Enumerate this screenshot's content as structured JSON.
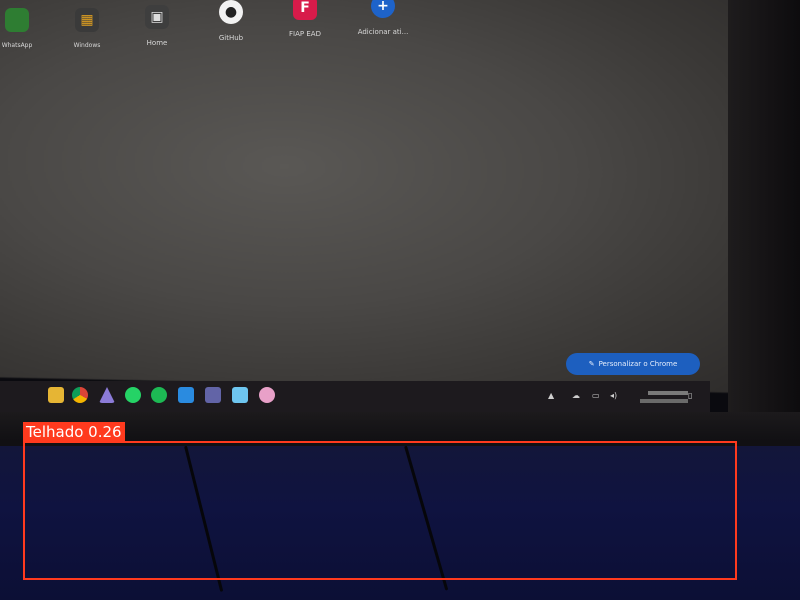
{
  "desktop": {
    "icons": [
      {
        "label": "WhatsApp",
        "color": "#2e7d32",
        "glyph": "●",
        "icon": "whatsapp-icon"
      },
      {
        "label": "Windows",
        "color": "#c0392b",
        "glyph": "▦",
        "icon": "windows-apps-icon"
      },
      {
        "label": "Home",
        "color": "#555555",
        "glyph": "▣",
        "icon": "home-icon"
      },
      {
        "label": "GitHub",
        "color": "#f2f2f2",
        "glyph": "●",
        "icon": "github-icon"
      },
      {
        "label": "FIAP EAD",
        "color": "#d81b4a",
        "glyph": "F",
        "icon": "fiap-icon"
      },
      {
        "label": "Adicionar ati...",
        "color": "#1e63c9",
        "glyph": "+",
        "icon": "add-shortcut-icon"
      }
    ],
    "customize_button": "Personalizar o Chrome"
  },
  "taskbar": {
    "apps": [
      {
        "name": "file-explorer",
        "color": "#e6b534"
      },
      {
        "name": "chrome",
        "color": "#db4437"
      },
      {
        "name": "app-purple",
        "color": "#8c7bd8"
      },
      {
        "name": "whatsapp",
        "color": "#25d366"
      },
      {
        "name": "spotify",
        "color": "#1db954"
      },
      {
        "name": "vscode",
        "color": "#2a8be0"
      },
      {
        "name": "teams",
        "color": "#6264a7"
      },
      {
        "name": "notepad",
        "color": "#6ec6f0"
      },
      {
        "name": "other",
        "color": "#e8a0c8"
      }
    ]
  },
  "detection": {
    "label": "Telhado 0.26",
    "color": "#ff3a1e"
  }
}
